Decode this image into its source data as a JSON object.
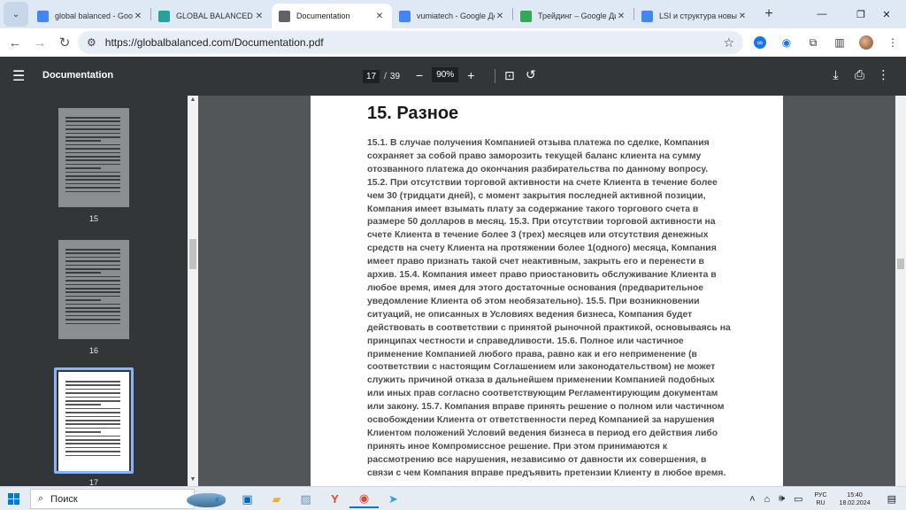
{
  "browser": {
    "tabs": [
      {
        "label": "global balanced - Goog",
        "icon": "google-docs-icon",
        "color": "#4285f4",
        "active": false
      },
      {
        "label": "GLOBAL BALANCED FUND",
        "icon": "site-icon",
        "color": "#2aa198",
        "active": false
      },
      {
        "label": "Documentation",
        "icon": "globe-icon",
        "color": "#5f6368",
        "active": true
      },
      {
        "label": "vumiatech - Google Док",
        "icon": "google-docs-icon",
        "color": "#4285f4",
        "active": false
      },
      {
        "label": "Трейдинг – Google Дис",
        "icon": "google-drive-icon",
        "color": "#34a853",
        "active": false
      },
      {
        "label": "LSI и структура новые",
        "icon": "google-docs-icon",
        "color": "#4285f4",
        "active": false
      }
    ],
    "url": "https://globalbalanced.com/Documentation.pdf"
  },
  "pdf_viewer": {
    "title": "Documentation",
    "current_page": "17",
    "total_pages": "39",
    "zoom": "90%",
    "thumbnails": [
      {
        "number": "15",
        "selected": false
      },
      {
        "number": "16",
        "selected": false
      },
      {
        "number": "17",
        "selected": true
      }
    ]
  },
  "document": {
    "heading": "15. Разное",
    "lines": [
      "15.1. В случае получения Компанией отзыва платежа по сделке, Компания",
      "сохраняет за собой право заморозить текущей баланс клиента на сумму",
      "отозванного платежа до окончания разбирательства по данному вопросу.",
      "15.2. При отсутствии торговой активности на счете Клиента в течение более",
      "чем 30 (тридцати дней), с момент закрытия последней активной позиции,",
      "Компания имеет взымать плату за содержание такого торгового счета в",
      "размере 50 долларов в месяц. 15.3. При отсутствии торговой активности на",
      "счете Клиента в течение более 3 (трех) месяцев или отсутствия денежных",
      "средств на счету Клиента на протяжении более 1(одного) месяца, Компания",
      "имеет право признать такой счет неактивным, закрыть его и перенести в",
      "архив. 15.4. Компания имеет право приостановить обслуживание Клиента в",
      "любое время, имея для этого достаточные основания (предварительное",
      "уведомление Клиента об этом необязательно). 15.5. При возникновении",
      "ситуаций, не описанных в Условиях ведения бизнеса, Компания будет",
      "действовать в соответствии с принятой рыночной практикой, основываясь на",
      "принципах честности и справедливости. 15.6. Полное или частичное",
      "применение Компанией любого права, равно как и его неприменение (в",
      "соответствии с настоящим Соглашением или законодательством) не может",
      "служить причиной отказа в дальнейшем применении Компанией подобных",
      "или иных прав согласно соответствующим Регламентирующим документам",
      "или закону. 15.7. Компания вправе принять решение о полном или частичном",
      "освобождении Клиента от ответственности перед Компанией за нарушения",
      "Клиентом положений Условий ведения бизнеса в период его действия либо",
      "принять иное Компромиссное решение. При этом принимаются к",
      "рассмотрению все нарушения, независимо от давности их совершения, в",
      "связи с чем Компания вправе предъявить претензии Клиенту в любое время."
    ]
  },
  "taskbar": {
    "search_placeholder": "Поиск",
    "language_top": "РУС",
    "language_bottom": "RU",
    "time": "15:40",
    "date": "18.02.2024"
  }
}
